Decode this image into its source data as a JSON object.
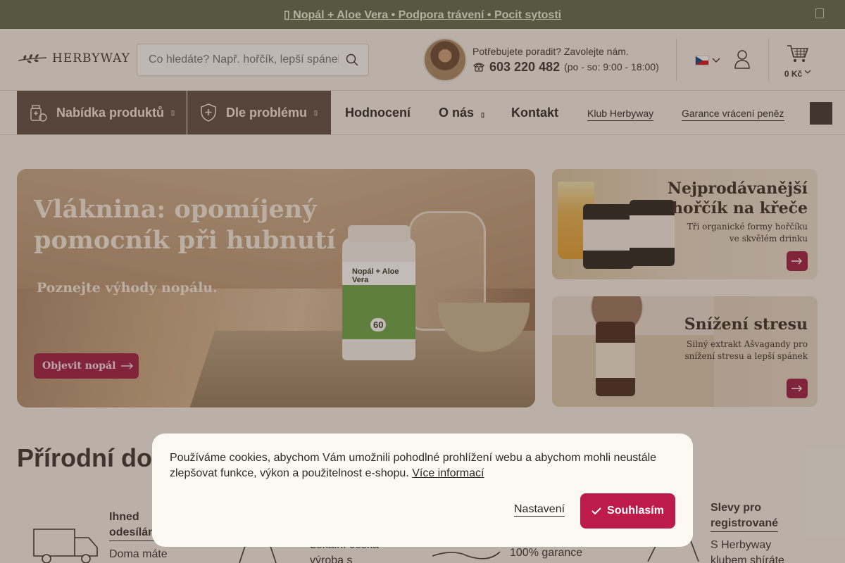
{
  "promo": {
    "text": "Nopál + Aloe Vera • Podpora trávení • Pocit sytosti",
    "icon": "leaf-icon"
  },
  "header": {
    "logo": "HERBYWAY",
    "search_placeholder": "Co hledáte? Např. hořčík, lepší spánek",
    "contact_question": "Potřebujete poradit? Zavolejte nám.",
    "phone": "603 220 482",
    "hours": "(po - so: 9:00 - 18:00)",
    "cart_total": "0 Kč"
  },
  "nav": {
    "products": "Nabídka produktů",
    "problem": "Dle problému",
    "reviews": "Hodnocení",
    "about": "O nás",
    "contact": "Kontakt",
    "club": "Klub Herbyway",
    "guarantee": "Garance vrácení peněz"
  },
  "hero": {
    "title_line1": "Vláknina: opomíjený",
    "title_line2": "pomocník při hubnutí",
    "subtitle": "Poznejte výhody nopálu.",
    "cta": "Objevit nopál",
    "product_label": "Nopál + Aloe Vera",
    "product_count": "60"
  },
  "banners": [
    {
      "title_line1": "Nejprodávanější",
      "title_line2": "hořčík na křeče",
      "text_line1": "Tři organické formy hořčíku",
      "text_line2": "ve skvělém drinku"
    },
    {
      "title_line1": "Snížení stresu",
      "text_line1": "Silný extrakt Ašvagandy pro",
      "text_line2": "snížení stresu a lepší spánek"
    }
  ],
  "section": {
    "title": "Přírodní do",
    "features": [
      {
        "title_line1": "Ihned",
        "title_line2": "odesílán",
        "text": "Doma máte"
      },
      {
        "text_line1": "Lokální česká",
        "text_line2": "výroba s"
      },
      {
        "text": "100% garance"
      },
      {
        "title_line1": "Slevy pro",
        "title_line2": "registrované",
        "text_line1": "S Herbyway",
        "text_line2": "klubem shíráte"
      }
    ]
  },
  "cookie": {
    "message": "Používáme cookies, abychom Vám umožnili pohodlné prohlížení webu a abychom mohli neustále zlepšovat funkce, výkon a použitelnost e-shopu.",
    "more": "Více informací",
    "settings": "Nastavení",
    "agree": "Souhlasím"
  },
  "colors": {
    "accent": "#bd1c4b",
    "promo_bg": "#5f6e4b",
    "nav_dark": "#5e4c42"
  }
}
